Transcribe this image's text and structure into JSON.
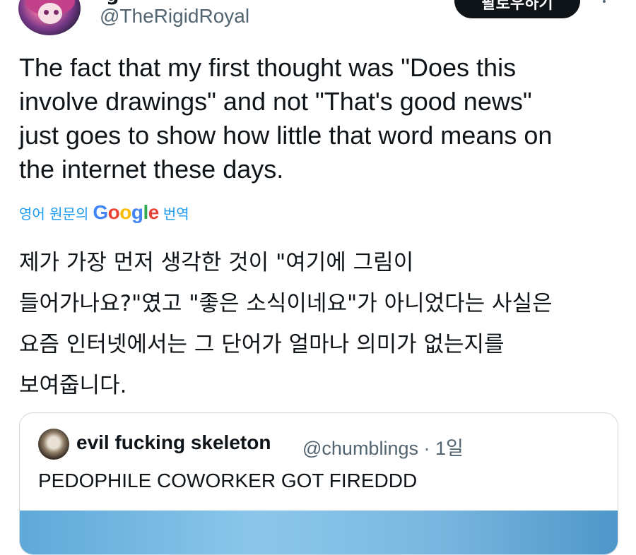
{
  "author": {
    "name_partial": "g",
    "handle": "@TheRigidRoyal",
    "avatar_icon": "avatar-anime-character"
  },
  "follow_button": {
    "label": "팔로우하기"
  },
  "more_icon": "more-vertical-icon",
  "tweet": {
    "text": "The fact that my first thought was \"Does this\ninvolve drawings\" and not \"That's good news\"\njust goes to show how little that word means on\nthe internet these days."
  },
  "translation": {
    "prefix": "영어 원문의",
    "google_logo": "Google",
    "suffix": "번역",
    "text": "제가 가장 먼저 생각한 것이 \"여기에 그림이\n들어가나요?\"였고 \"좋은 소식이네요\"가 아니었다는 사실은\n요즘 인터넷에서는 그 단어가 얼마나 의미가 없는지를\n보여줍니다."
  },
  "quote": {
    "author_name": "evil fucking skeleton",
    "handle": "@chumblings",
    "separator": "·",
    "time": "1일",
    "text": "PEDOPHILE COWORKER GOT FIREDDD"
  },
  "colors": {
    "link_blue": "#1d9bf0",
    "secondary_text": "#536471",
    "google_blue": "#4285F4",
    "google_red": "#EA4335",
    "google_yellow": "#FBBC05",
    "google_green": "#34A853"
  }
}
